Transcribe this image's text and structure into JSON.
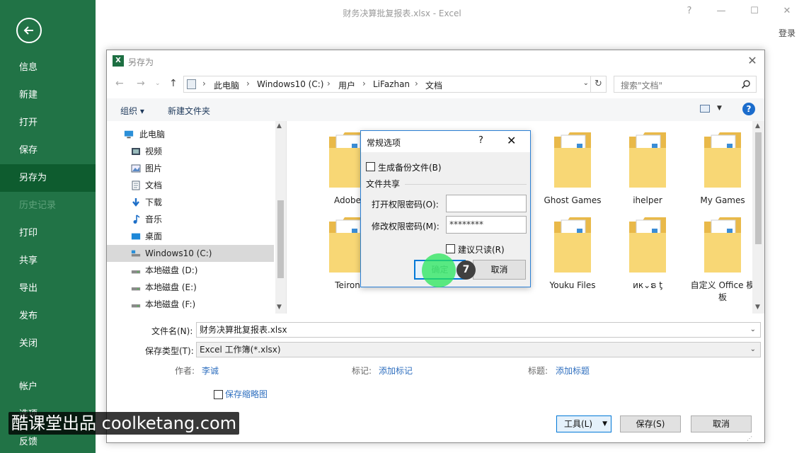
{
  "window": {
    "title": "财务决算批复报表.xlsx - Excel",
    "help": "?",
    "minimize": "—",
    "maximize": "☐",
    "close": "✕",
    "signin": "登录"
  },
  "backstage": {
    "items": [
      {
        "label": "信息"
      },
      {
        "label": "新建"
      },
      {
        "label": "打开"
      },
      {
        "label": "保存"
      },
      {
        "label": "另存为",
        "active": true
      },
      {
        "label": "历史记录",
        "disabled": true
      },
      {
        "label": "打印"
      },
      {
        "label": "共享"
      },
      {
        "label": "导出"
      },
      {
        "label": "发布"
      },
      {
        "label": "关闭"
      },
      {
        "label": "帐户"
      },
      {
        "label": "选项"
      },
      {
        "label": "反馈"
      }
    ]
  },
  "saveas": {
    "title": "另存为",
    "breadcrumbs": [
      "此电脑",
      "Windows10 (C:)",
      "用户",
      "LiFazhan",
      "文档"
    ],
    "search_placeholder": "搜索\"文档\"",
    "organize": "组织 ▾",
    "new_folder": "新建文件夹",
    "help": "?",
    "tree": [
      {
        "label": "此电脑",
        "icon": "computer-icon"
      },
      {
        "label": "视频",
        "icon": "video-icon"
      },
      {
        "label": "图片",
        "icon": "pictures-icon"
      },
      {
        "label": "文档",
        "icon": "documents-icon"
      },
      {
        "label": "下载",
        "icon": "download-icon"
      },
      {
        "label": "音乐",
        "icon": "music-icon"
      },
      {
        "label": "桌面",
        "icon": "desktop-icon"
      },
      {
        "label": "Windows10 (C:)",
        "icon": "drive-icon",
        "selected": true
      },
      {
        "label": "本地磁盘 (D:)",
        "icon": "drive-icon"
      },
      {
        "label": "本地磁盘 (E:)",
        "icon": "drive-icon"
      },
      {
        "label": "本地磁盘 (F:)",
        "icon": "drive-icon"
      }
    ],
    "folders": [
      {
        "name": "Adobe"
      },
      {
        "name": ""
      },
      {
        "name": ""
      },
      {
        "name": "Ghost Games"
      },
      {
        "name": "ihelper"
      },
      {
        "name": "My Games"
      },
      {
        "name": "Teiron"
      },
      {
        "name": ""
      },
      {
        "name": ""
      },
      {
        "name": "Youku Files"
      },
      {
        "name": "ик⌄ຣ ƫ"
      },
      {
        "name": "自定义 Office 模板"
      }
    ],
    "filename_label": "文件名(N):",
    "filename_value": "财务决算批复报表.xlsx",
    "filetype_label": "保存类型(T):",
    "filetype_value": "Excel 工作簿(*.xlsx)",
    "author_label": "作者:",
    "author_value": "李诚",
    "tags_label": "标记:",
    "tags_value": "添加标记",
    "subject_label": "标题:",
    "subject_value": "添加标题",
    "thumbnail_label": "保存缩略图",
    "tools_label": "工具(L)",
    "save_label": "保存(S)",
    "cancel_label": "取消"
  },
  "options_dialog": {
    "title": "常规选项",
    "help": "?",
    "close": "✕",
    "backup_label": "生成备份文件(B)",
    "sharing_label": "文件共享",
    "open_pwd_label": "打开权限密码(O):",
    "open_pwd_value": "",
    "modify_pwd_label": "修改权限密码(M):",
    "modify_pwd_value": "********",
    "readonly_label": "建议只读(R)",
    "ok_label": "确定",
    "cancel_label": "取消",
    "step_number": "7"
  },
  "watermark": "酷课堂出品 coolketang.com",
  "colors": {
    "excel_green": "#217346",
    "backstage_active": "#0e5c2f",
    "accent_blue": "#0078d7",
    "folder_yellow": "#f8d775",
    "click_highlight": "#28e65a"
  }
}
